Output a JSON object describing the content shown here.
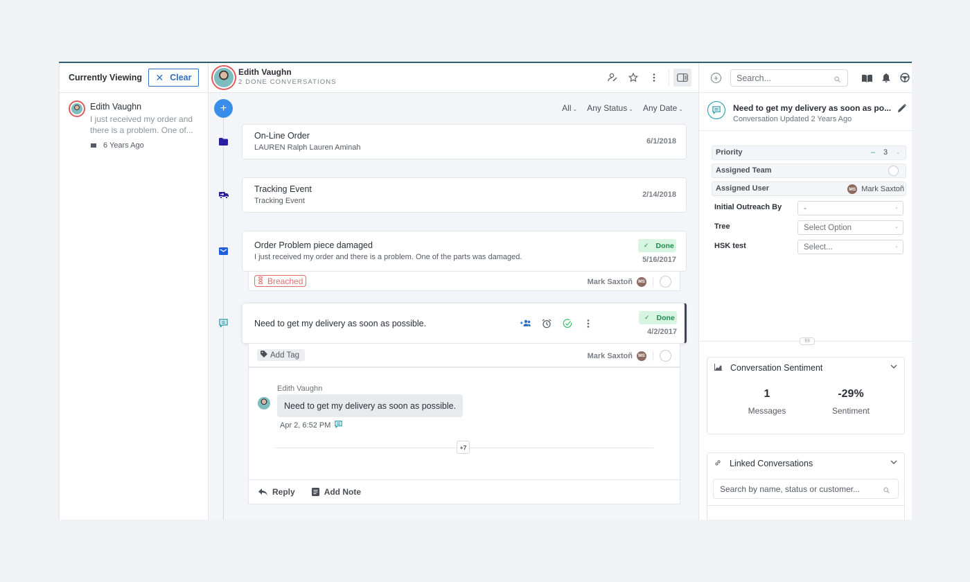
{
  "left_panel": {
    "title": "Currently Viewing",
    "clear_label": "Clear",
    "item": {
      "name": "Edith Vaughn",
      "snippet": "I just received my order and there is a problem. One of...",
      "time": "6 Years Ago",
      "channel_icon": "mail-icon"
    }
  },
  "header": {
    "customer_name": "Edith Vaughn",
    "subtitle": "2 DONE CONVERSATIONS",
    "icons": [
      "assign-user-icon",
      "star-icon",
      "more-vertical-icon",
      "panel-toggle-icon"
    ]
  },
  "filters": [
    {
      "label": "All"
    },
    {
      "label": "Any Status"
    },
    {
      "label": "Any Date"
    }
  ],
  "timeline": [
    {
      "icon": "folder-icon",
      "title": "On-Line Order",
      "subtitle": "LAUREN Ralph Lauren Aminah",
      "date": "6/1/2018"
    },
    {
      "icon": "truck-icon",
      "title": "Tracking Event",
      "subtitle": "Tracking Event",
      "date": "2/14/2018"
    },
    {
      "icon": "mail-icon",
      "title": "Order Problem piece damaged",
      "subtitle": "I just received my order and there is a problem. One of the parts was damaged.",
      "status": "Done",
      "date": "5/16/2017",
      "sla": "Breached",
      "assignee": "Mark Saxtoñ",
      "assignee_initials": "MS"
    },
    {
      "icon": "chat-icon",
      "title": "Need to get my delivery as soon as possible.",
      "status": "Done",
      "date": "4/2/2017",
      "tag_label": "Add Tag",
      "assignee": "Mark Saxtoñ",
      "assignee_initials": "MS"
    }
  ],
  "thread": {
    "author": "Edith Vaughn",
    "message": "Need to get my delivery as soon as possible.",
    "time": "Apr 2, 6:52 PM",
    "more_count": "+7",
    "reply_label": "Reply",
    "note_label": "Add Note"
  },
  "right_panel": {
    "search_placeholder": "Search...",
    "conversation_title": "Need to get my delivery as soon as po...",
    "conversation_sub": "Conversation Updated 2 Years Ago",
    "props": {
      "priority_label": "Priority",
      "priority_value": "3",
      "team_label": "Assigned Team",
      "user_label": "Assigned User",
      "user_value": "Mark Saxtoñ",
      "user_initials": "MS",
      "outreach_label": "Initial Outreach By",
      "outreach_value": "-",
      "tree_label": "Tree",
      "tree_value": "Select Option",
      "hsk_label": "HSK test",
      "hsk_value": "Select..."
    },
    "sentiment": {
      "title": "Conversation Sentiment",
      "messages_value": "1",
      "messages_label": "Messages",
      "sentiment_value": "-29%",
      "sentiment_label": "Sentiment"
    },
    "linked": {
      "title": "Linked Conversations",
      "search_placeholder": "Search by name, status or customer..."
    }
  },
  "colors": {
    "accent": "#2c6fbf",
    "add_button": "#3a8ee9",
    "done_bg": "#d8f5e2",
    "done_text": "#1f8a4c",
    "breached": "#e06e6e",
    "chat_teal": "#1c9aa6",
    "timeline_purple": "#2a1fa0"
  }
}
